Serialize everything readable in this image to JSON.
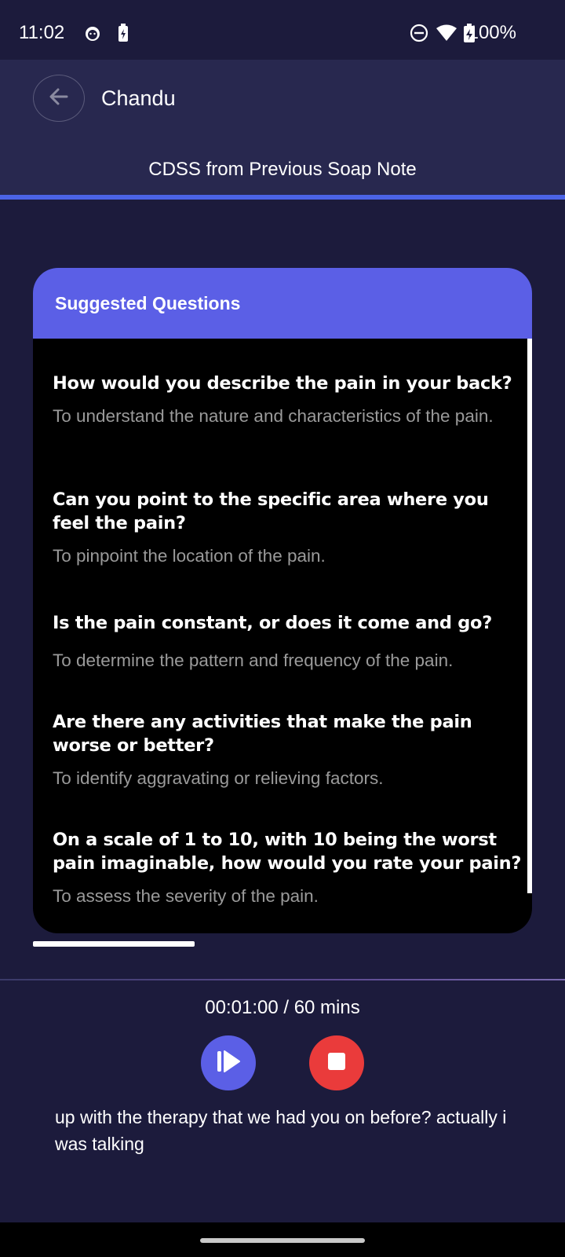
{
  "status_bar": {
    "time": "11:02",
    "battery": "100%",
    "icons": [
      "cat-notification-icon",
      "battery-saver-icon",
      "do-not-disturb-icon",
      "wifi-icon",
      "battery-charging-icon"
    ]
  },
  "header": {
    "title": "Chandu",
    "subtitle": "CDSS from Previous Soap Note"
  },
  "card": {
    "title": "Suggested Questions",
    "questions": [
      {
        "question": "How would you describe the pain in your back?",
        "rationale": "To understand the nature and characteristics of the pain."
      },
      {
        "question": "Can you point to the specific area where you feel the pain?",
        "rationale": "To pinpoint the location of the pain."
      },
      {
        "question": "Is the pain constant, or does it come and go?",
        "rationale": "To determine the pattern and frequency of the pain."
      },
      {
        "question": "Are there any activities that make the pain worse or better?",
        "rationale": "To identify aggravating or relieving factors."
      },
      {
        "question": "On a scale of 1 to 10, with 10 being the worst pain imaginable, how would you rate your pain?",
        "rationale": "To assess the severity of the pain."
      }
    ]
  },
  "recorder": {
    "timer": "00:01:00 / 60 mins",
    "transcript": "up with the therapy that we had you on before? actually i was talking"
  },
  "colors": {
    "background": "#1c1b3c",
    "header_bg": "#28284f",
    "accent": "#5b5fe6",
    "stop": "#ea3b3b"
  }
}
